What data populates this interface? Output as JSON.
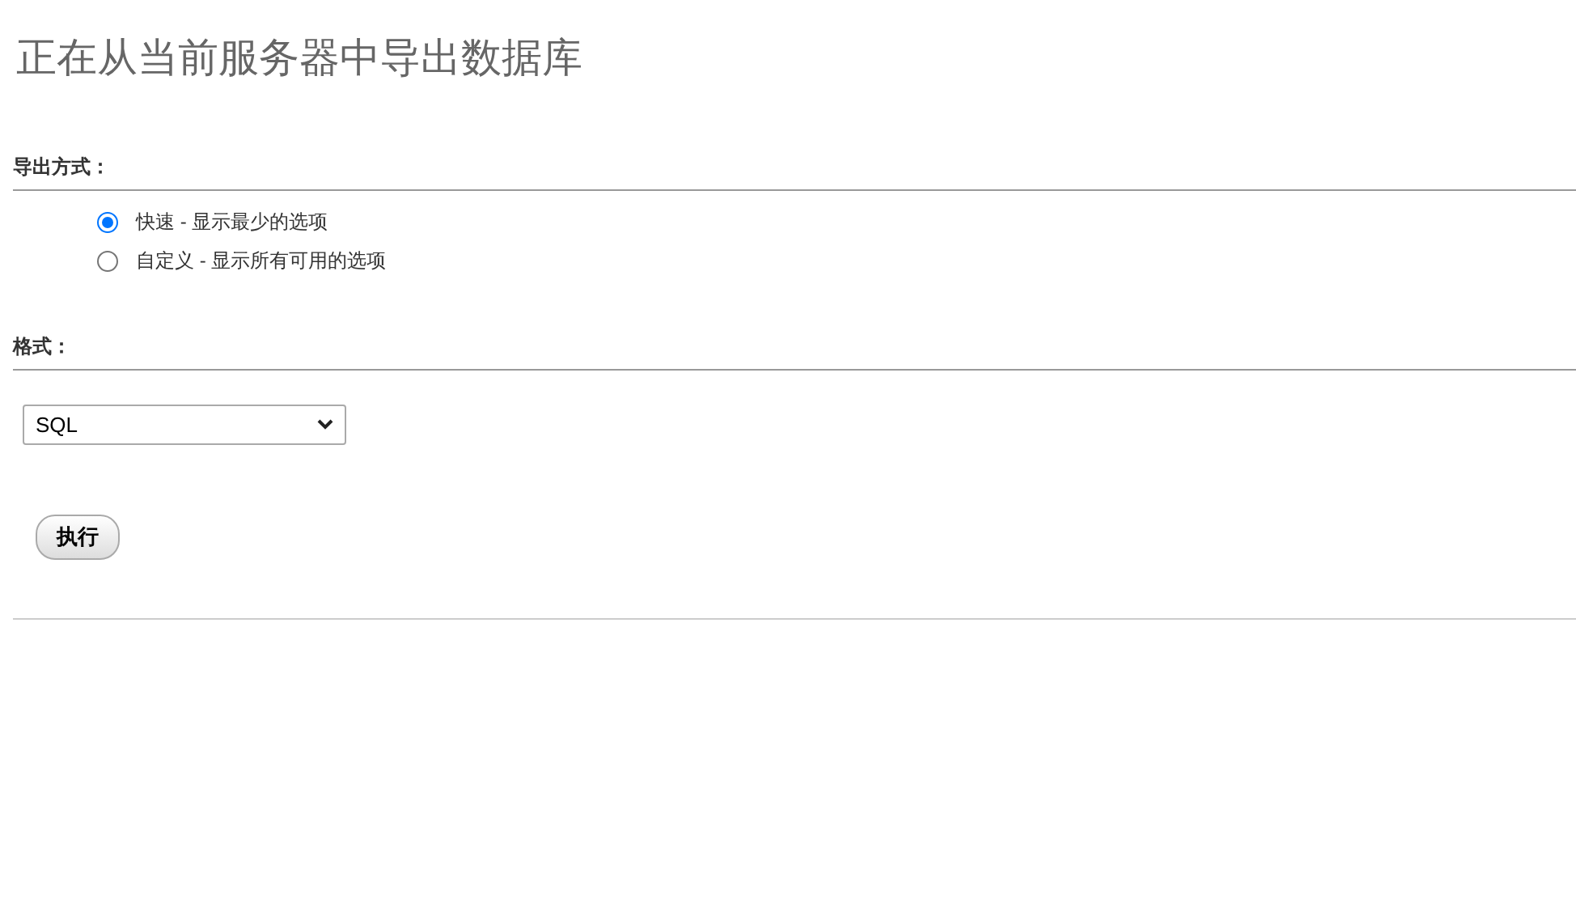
{
  "title": "正在从当前服务器中导出数据库",
  "export_method": {
    "label": "导出方式：",
    "options": [
      {
        "label": "快速 - 显示最少的选项",
        "selected": true
      },
      {
        "label": "自定义 - 显示所有可用的选项",
        "selected": false
      }
    ]
  },
  "format": {
    "label": "格式：",
    "value": "SQL"
  },
  "buttons": [
    "执行"
  ]
}
